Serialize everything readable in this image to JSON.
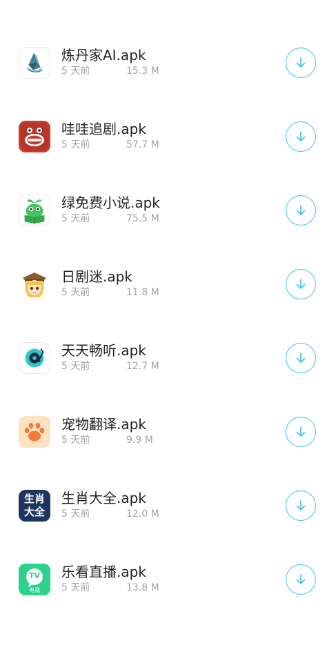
{
  "accent": "#39c0ee",
  "files": [
    {
      "name": "炼丹家AI.apk",
      "age": "5 天前",
      "size": "15.3 M",
      "icon": "ai-crystal-icon"
    },
    {
      "name": "哇哇追剧.apk",
      "age": "5 天前",
      "size": "57.7 M",
      "icon": "open-mouth-face-icon"
    },
    {
      "name": "绿免费小说.apk",
      "age": "5 天前",
      "size": "75.5 M",
      "icon": "green-sprout-book-icon"
    },
    {
      "name": "日剧迷.apk",
      "age": "5 天前",
      "size": "11.8 M",
      "icon": "anime-girl-avatar-icon"
    },
    {
      "name": "天天畅听.apk",
      "age": "5 天前",
      "size": "12.7 M",
      "icon": "vinyl-record-icon"
    },
    {
      "name": "宠物翻译.apk",
      "age": "5 天前",
      "size": "9.9 M",
      "icon": "paw-print-icon"
    },
    {
      "name": "生肖大全.apk",
      "age": "5 天前",
      "size": "12.0 M",
      "icon": "zodiac-text-logo-icon",
      "logo_text": [
        "生肖",
        "大全"
      ]
    },
    {
      "name": "乐看直播.apk",
      "age": "5 天前",
      "size": "13.8 M",
      "icon": "tv-bubble-icon",
      "logo_text": [
        "TV",
        "电视"
      ]
    }
  ]
}
